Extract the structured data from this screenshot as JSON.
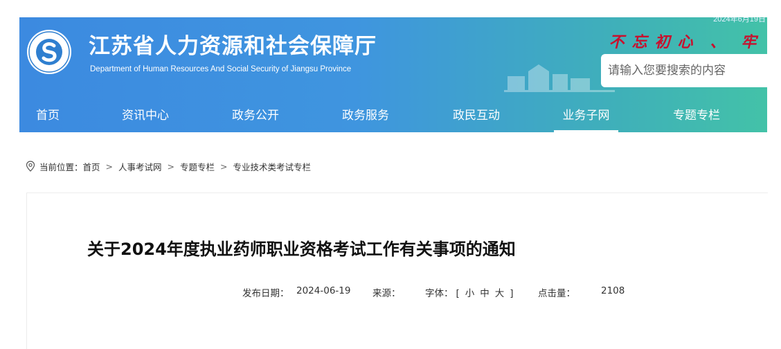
{
  "header": {
    "date": "2024年6月19日",
    "title": "江苏省人力资源和社会保障厅",
    "subtitle": "Department of Human Resources And Social Security of Jiangsu Province",
    "slogan_chars": [
      "不",
      "忘",
      "初",
      "心",
      "、",
      "牢"
    ],
    "search_placeholder": "请输入您要搜索的内容",
    "colors": {
      "gradient_start": "#3c8ae0",
      "gradient_end": "#43c2a8",
      "slogan": "#c8102e"
    }
  },
  "nav": {
    "items": [
      {
        "label": "首页"
      },
      {
        "label": "资讯中心"
      },
      {
        "label": "政务公开"
      },
      {
        "label": "政务服务"
      },
      {
        "label": "政民互动"
      },
      {
        "label": "业务子网",
        "active": true
      },
      {
        "label": "专题专栏"
      }
    ]
  },
  "breadcrumb": {
    "prefix": "当前位置：",
    "items": [
      "首页",
      "人事考试网",
      "专题专栏",
      "专业技术类考试专栏"
    ],
    "separator": ">"
  },
  "article": {
    "title": "关于2024年度执业药师职业资格考试工作有关事项的通知",
    "publish_label": "发布日期：",
    "publish_date": "2024-06-19",
    "source_label": "来源：",
    "source_value": "",
    "font_label": "字体：",
    "font_open": "[",
    "font_small": "小",
    "font_medium": "中",
    "font_large": "大",
    "font_close": "]",
    "views_label": "点击量：",
    "views": "2108"
  }
}
